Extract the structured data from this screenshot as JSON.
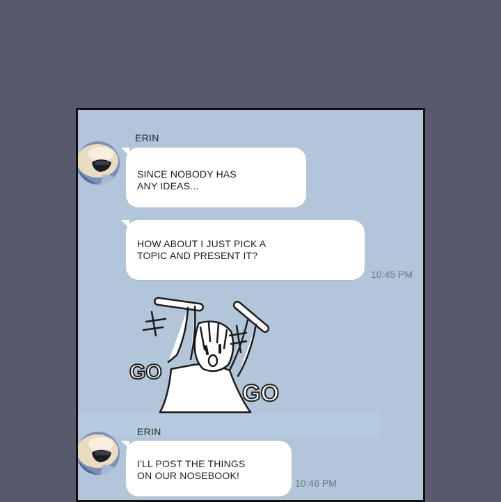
{
  "messages": [
    {
      "sender": "ERIN",
      "text": "SINCE NOBODY HAS\nANY IDEAS..."
    },
    {
      "text": "HOW ABOUT I JUST PICK A\nTOPIC AND PRESENT IT?",
      "time": "10:45 PM"
    },
    {
      "sticker": {
        "icon": "cheering-girl-sticker-icon",
        "text_left": "GO",
        "text_right": "GO"
      }
    },
    {
      "sender": "ERIN",
      "text": "I'LL POST THE THINGS\nON OUR NOSEBOOK!",
      "time": "10:46 PM"
    }
  ],
  "colors": {
    "page_background": "#575a6d",
    "chat_background": "#b2c5d9",
    "bubble": "#ffffff",
    "timestamp": "#6e7784"
  }
}
